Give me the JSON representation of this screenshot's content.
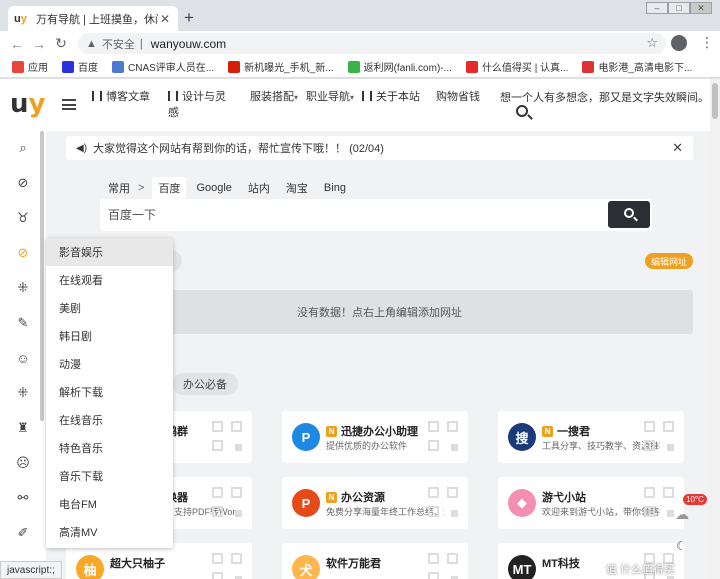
{
  "browser": {
    "tab_title": "万有导航 | 上班摸鱼，休闲娱乐",
    "tab_logo": "u",
    "tab_logo_accent": "y",
    "new_tab": "+",
    "address": {
      "security_label": "不安全",
      "separator": "|",
      "url": "wanyouw.com"
    },
    "bookmarks": [
      {
        "label": "应用",
        "color": "#e8453c"
      },
      {
        "label": "百度",
        "color": "#2932e1"
      },
      {
        "label": "CNAS评审人员在...",
        "color": "#4a7bd0"
      },
      {
        "label": "新机曝光_手机_新...",
        "color": "#d81e06"
      },
      {
        "label": "返利网(fanli.com)-...",
        "color": "#3bb34a"
      },
      {
        "label": "什么值得买 | 认真...",
        "color": "#e62828"
      },
      {
        "label": "电影港_高清电影下...",
        "color": "#d33"
      }
    ]
  },
  "header": {
    "logo_main": "u",
    "logo_accent": "y",
    "nav": [
      {
        "label": "博客文章",
        "has_icon": true
      },
      {
        "label": "设计与灵感",
        "has_icon": true
      },
      {
        "label": "服装搭配",
        "caret": "▾"
      },
      {
        "label": "职业导航",
        "caret": "▾"
      },
      {
        "label": "关于本站",
        "has_icon": true
      },
      {
        "label": "购物省钱"
      }
    ],
    "slogan": "想一个人有多想念，那又是文字失效瞬间。"
  },
  "notice": {
    "text": "大家觉得这个网站有帮到你的话，帮忙宣传下哦！！ (02/04)"
  },
  "search": {
    "tabs": [
      "常用",
      "百度",
      "Google",
      "站内",
      "淘宝",
      "Bing"
    ],
    "tabs_separator": ">",
    "active_tab": "百度",
    "placeholder": "百度一下"
  },
  "edit_button": "编辑网址",
  "empty_message": "没有数据！点右上角编辑添加网址",
  "category_pill": "办公必备",
  "cards": [
    {
      "title": "鸭群",
      "desc": "",
      "icon_color": "#fff",
      "icon_text": ""
    },
    {
      "title": "迅捷办公小助理",
      "desc": "提供优质的办公软件",
      "icon_color": "#1e88e5",
      "icon_text": "P",
      "new": true
    },
    {
      "title": "一搜君",
      "desc": "工具分享、技巧教学、资源推荐...",
      "icon_color": "#1a3a7a",
      "icon_text": "搜",
      "new": true
    },
    {
      "title": "换器",
      "desc": "支持PDF转Wor...",
      "icon_color": "#fff",
      "icon_text": ""
    },
    {
      "title": "办公资源",
      "desc": "免费分享海量年终工作总结、述职...",
      "icon_color": "#e64a19",
      "icon_text": "P",
      "new": true
    },
    {
      "title": "游弋小站",
      "desc": "欢迎来到游弋小站，带你领略各种...",
      "icon_color": "#f48fb1",
      "icon_text": "◆"
    },
    {
      "title": "超大只柚子",
      "desc": "",
      "icon_color": "#f9a825",
      "icon_text": "柚"
    },
    {
      "title": "软件万能君",
      "desc": "",
      "icon_color": "#ffb74d",
      "icon_text": "犬"
    },
    {
      "title": "MT科技",
      "desc": "",
      "icon_color": "#222",
      "icon_text": "MT"
    }
  ],
  "dropdown": {
    "items": [
      "影音娱乐",
      "在线观看",
      "美剧",
      "韩日剧",
      "动漫",
      "解析下载",
      "在线音乐",
      "特色音乐",
      "音乐下载",
      "电台FM",
      "高清MV"
    ],
    "active": "影音娱乐"
  },
  "sidebar_icons": [
    "search-icon",
    "planet-icon",
    "medal-icon",
    "planet-active-icon",
    "apps-icon",
    "pen-icon",
    "smile-icon",
    "puzzle-icon",
    "tower-icon",
    "face-icon",
    "share-icon",
    "edit-icon",
    "book-icon"
  ],
  "weather": {
    "temp": "10°C"
  },
  "status_bar": "javascript:;",
  "watermark": "值 什么值得买"
}
